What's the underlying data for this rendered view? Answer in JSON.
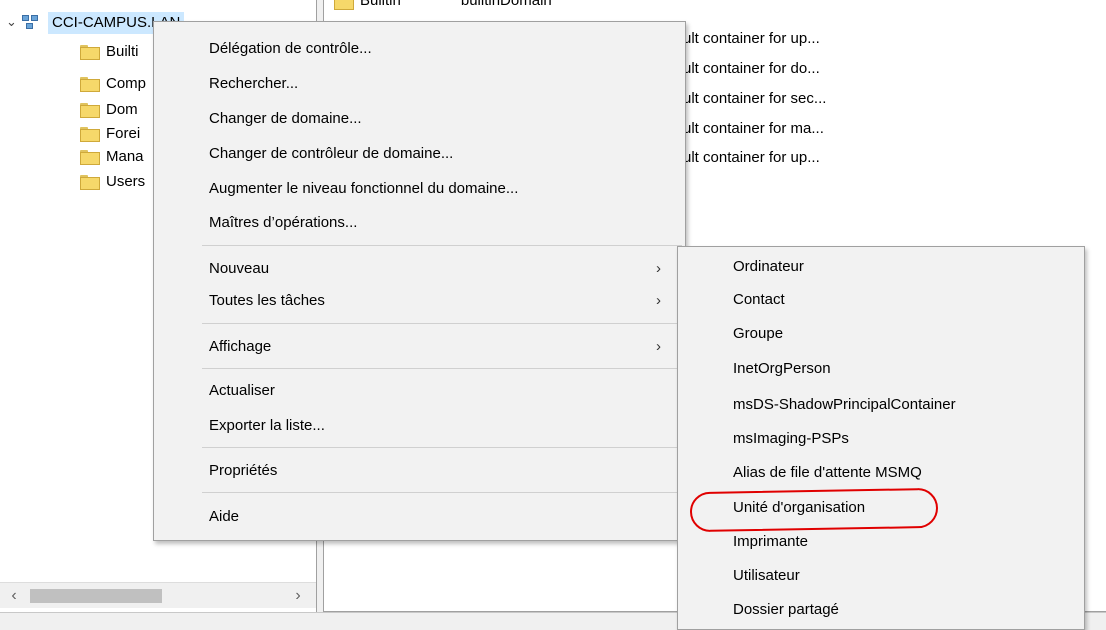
{
  "tree": {
    "root_label": "CCI-CAMPUS.LAN",
    "items": [
      {
        "label": "Builti",
        "icon": "folder-icon"
      },
      {
        "label": "Comp",
        "icon": "folder-icon"
      },
      {
        "label": "Dom",
        "icon": "domain-controllers-folder-icon"
      },
      {
        "label": "Forei",
        "icon": "folder-icon"
      },
      {
        "label": "Mana",
        "icon": "folder-icon"
      },
      {
        "label": "Users",
        "icon": "folder-icon"
      }
    ]
  },
  "list": {
    "partial_header": {
      "name": "Builtin",
      "type": "builtinDomain"
    },
    "descriptions": [
      "ult container for up...",
      "ult container for do...",
      "ult container for sec...",
      "ult container for ma...",
      "ult container for up..."
    ]
  },
  "context_menu": {
    "items": [
      "Délégation de contrôle...",
      "Rechercher...",
      "Changer de domaine...",
      "Changer de contrôleur de domaine...",
      "Augmenter le niveau fonctionnel du domaine...",
      "Maîtres d’opérations...",
      "Nouveau",
      "Toutes les tâches",
      "Affichage",
      "Actualiser",
      "Exporter la liste...",
      "Propriétés",
      "Aide"
    ],
    "submenu_arrow": "›"
  },
  "submenu_new": {
    "items": [
      "Ordinateur",
      "Contact",
      "Groupe",
      "InetOrgPerson",
      "msDS-ShadowPrincipalContainer",
      "msImaging-PSPs",
      "Alias de file d'attente MSMQ",
      "Unité d'organisation",
      "Imprimante",
      "Utilisateur",
      "Dossier partagé"
    ]
  },
  "colors": {
    "selection": "#cce8ff",
    "menu_bg": "#f2f2f2",
    "highlight": "#e00000"
  }
}
